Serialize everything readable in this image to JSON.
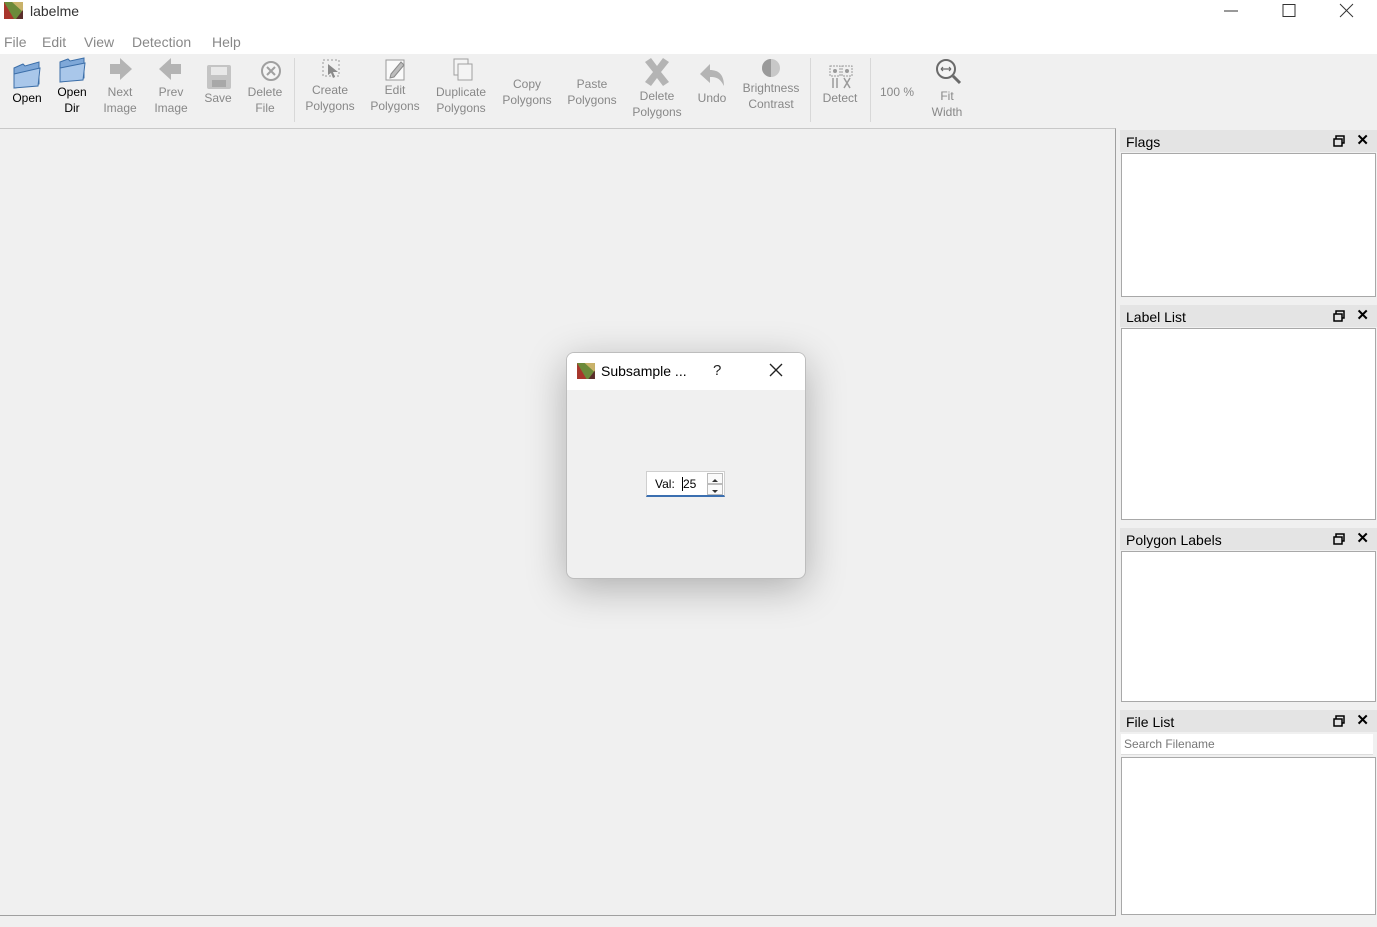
{
  "window": {
    "title": "labelme",
    "controls": [
      "minimize",
      "maximize",
      "close"
    ]
  },
  "menu": [
    "File",
    "Edit",
    "View",
    "Detection",
    "Help"
  ],
  "toolbar": {
    "open": "Open",
    "open_dir": "Open\nDir",
    "next_image": "Next\nImage",
    "prev_image": "Prev\nImage",
    "save": "Save",
    "delete_file": "Delete\nFile",
    "create_polygons": "Create\nPolygons",
    "edit_polygons": "Edit\nPolygons",
    "duplicate_polygons": "Duplicate\nPolygons",
    "copy_polygons": "Copy\nPolygons",
    "paste_polygons": "Paste\nPolygons",
    "delete_polygons": "Delete\nPolygons",
    "undo": "Undo",
    "brightness_contrast": "Brightness\nContrast",
    "detect": "Detect",
    "zoom": "100 %",
    "fit_width": "Fit\nWidth"
  },
  "docks": {
    "flags": "Flags",
    "label_list": "Label List",
    "polygon_labels": "Polygon Labels",
    "file_list": "File List",
    "search_placeholder": "Search Filename"
  },
  "dialog": {
    "title": "Subsample ...",
    "help": "?",
    "spin_prefix": "Val:",
    "spin_value": "25"
  }
}
